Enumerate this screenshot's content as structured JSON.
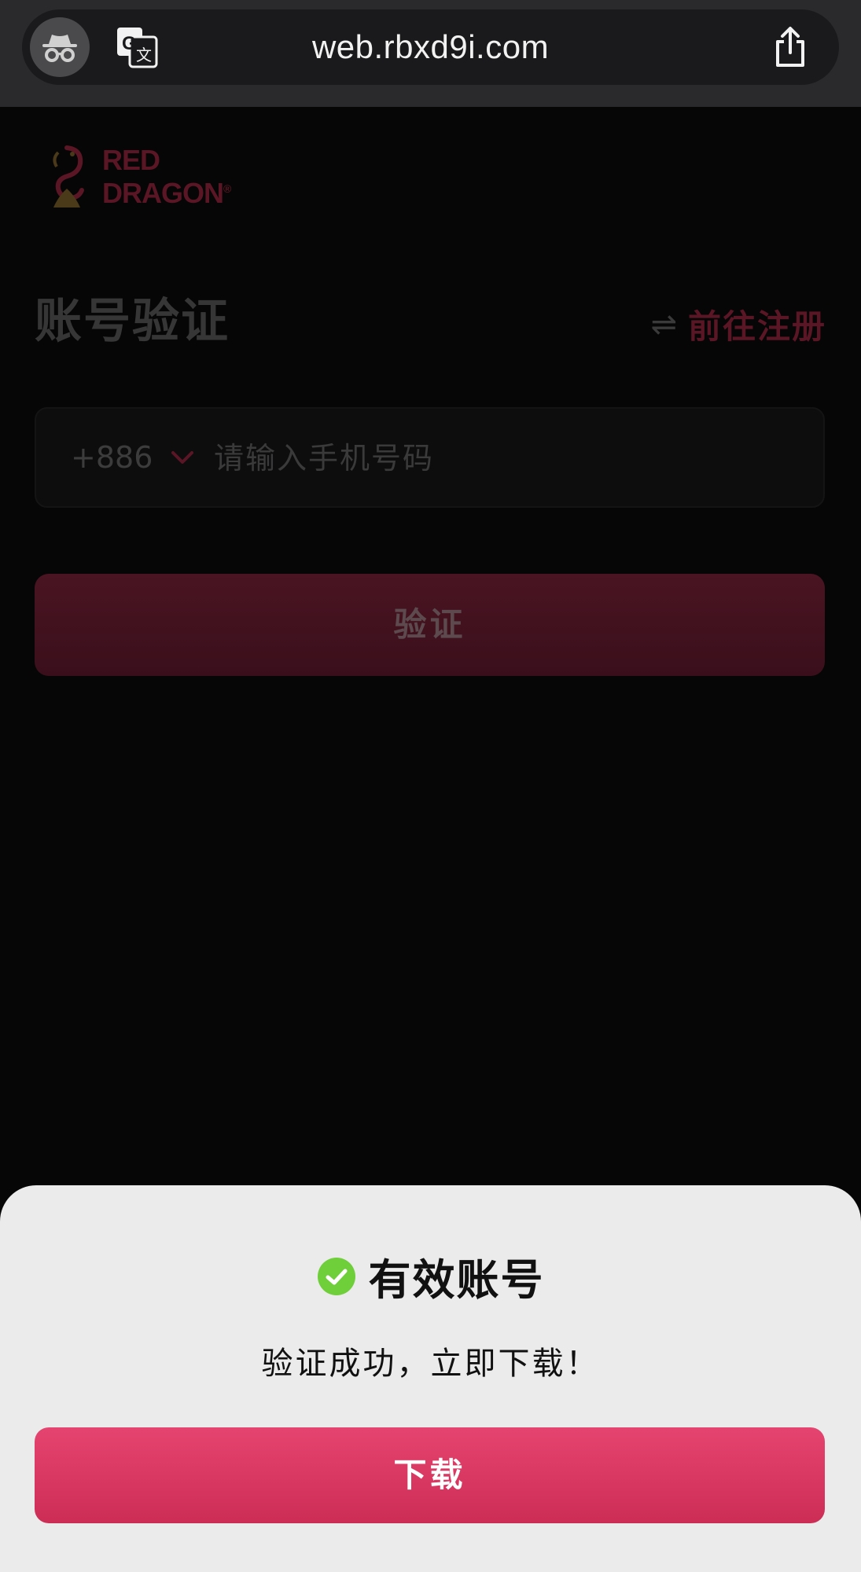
{
  "browser": {
    "url": "web.rbxd9i.com",
    "icons": {
      "incognito": "incognito-icon",
      "translate": "translate-icon",
      "share": "share-icon"
    }
  },
  "page": {
    "logo": {
      "line1": "RED",
      "line2": "DRAGON",
      "mark": "®",
      "icon": "dragon-logo-icon"
    },
    "title": "账号验证",
    "register_link": {
      "icon_glyph": "⇌",
      "label": "前往注册"
    },
    "phone_field": {
      "country_code": "+886",
      "placeholder": "请输入手机号码",
      "value": ""
    },
    "verify_button": "验证"
  },
  "sheet": {
    "title": "有效账号",
    "message": "验证成功，立即下载！",
    "download_button": "下载"
  },
  "colors": {
    "accent": "#d93460",
    "success": "#6fcf3a",
    "sheet_background": "#ebebeb",
    "page_background": "#060606"
  }
}
